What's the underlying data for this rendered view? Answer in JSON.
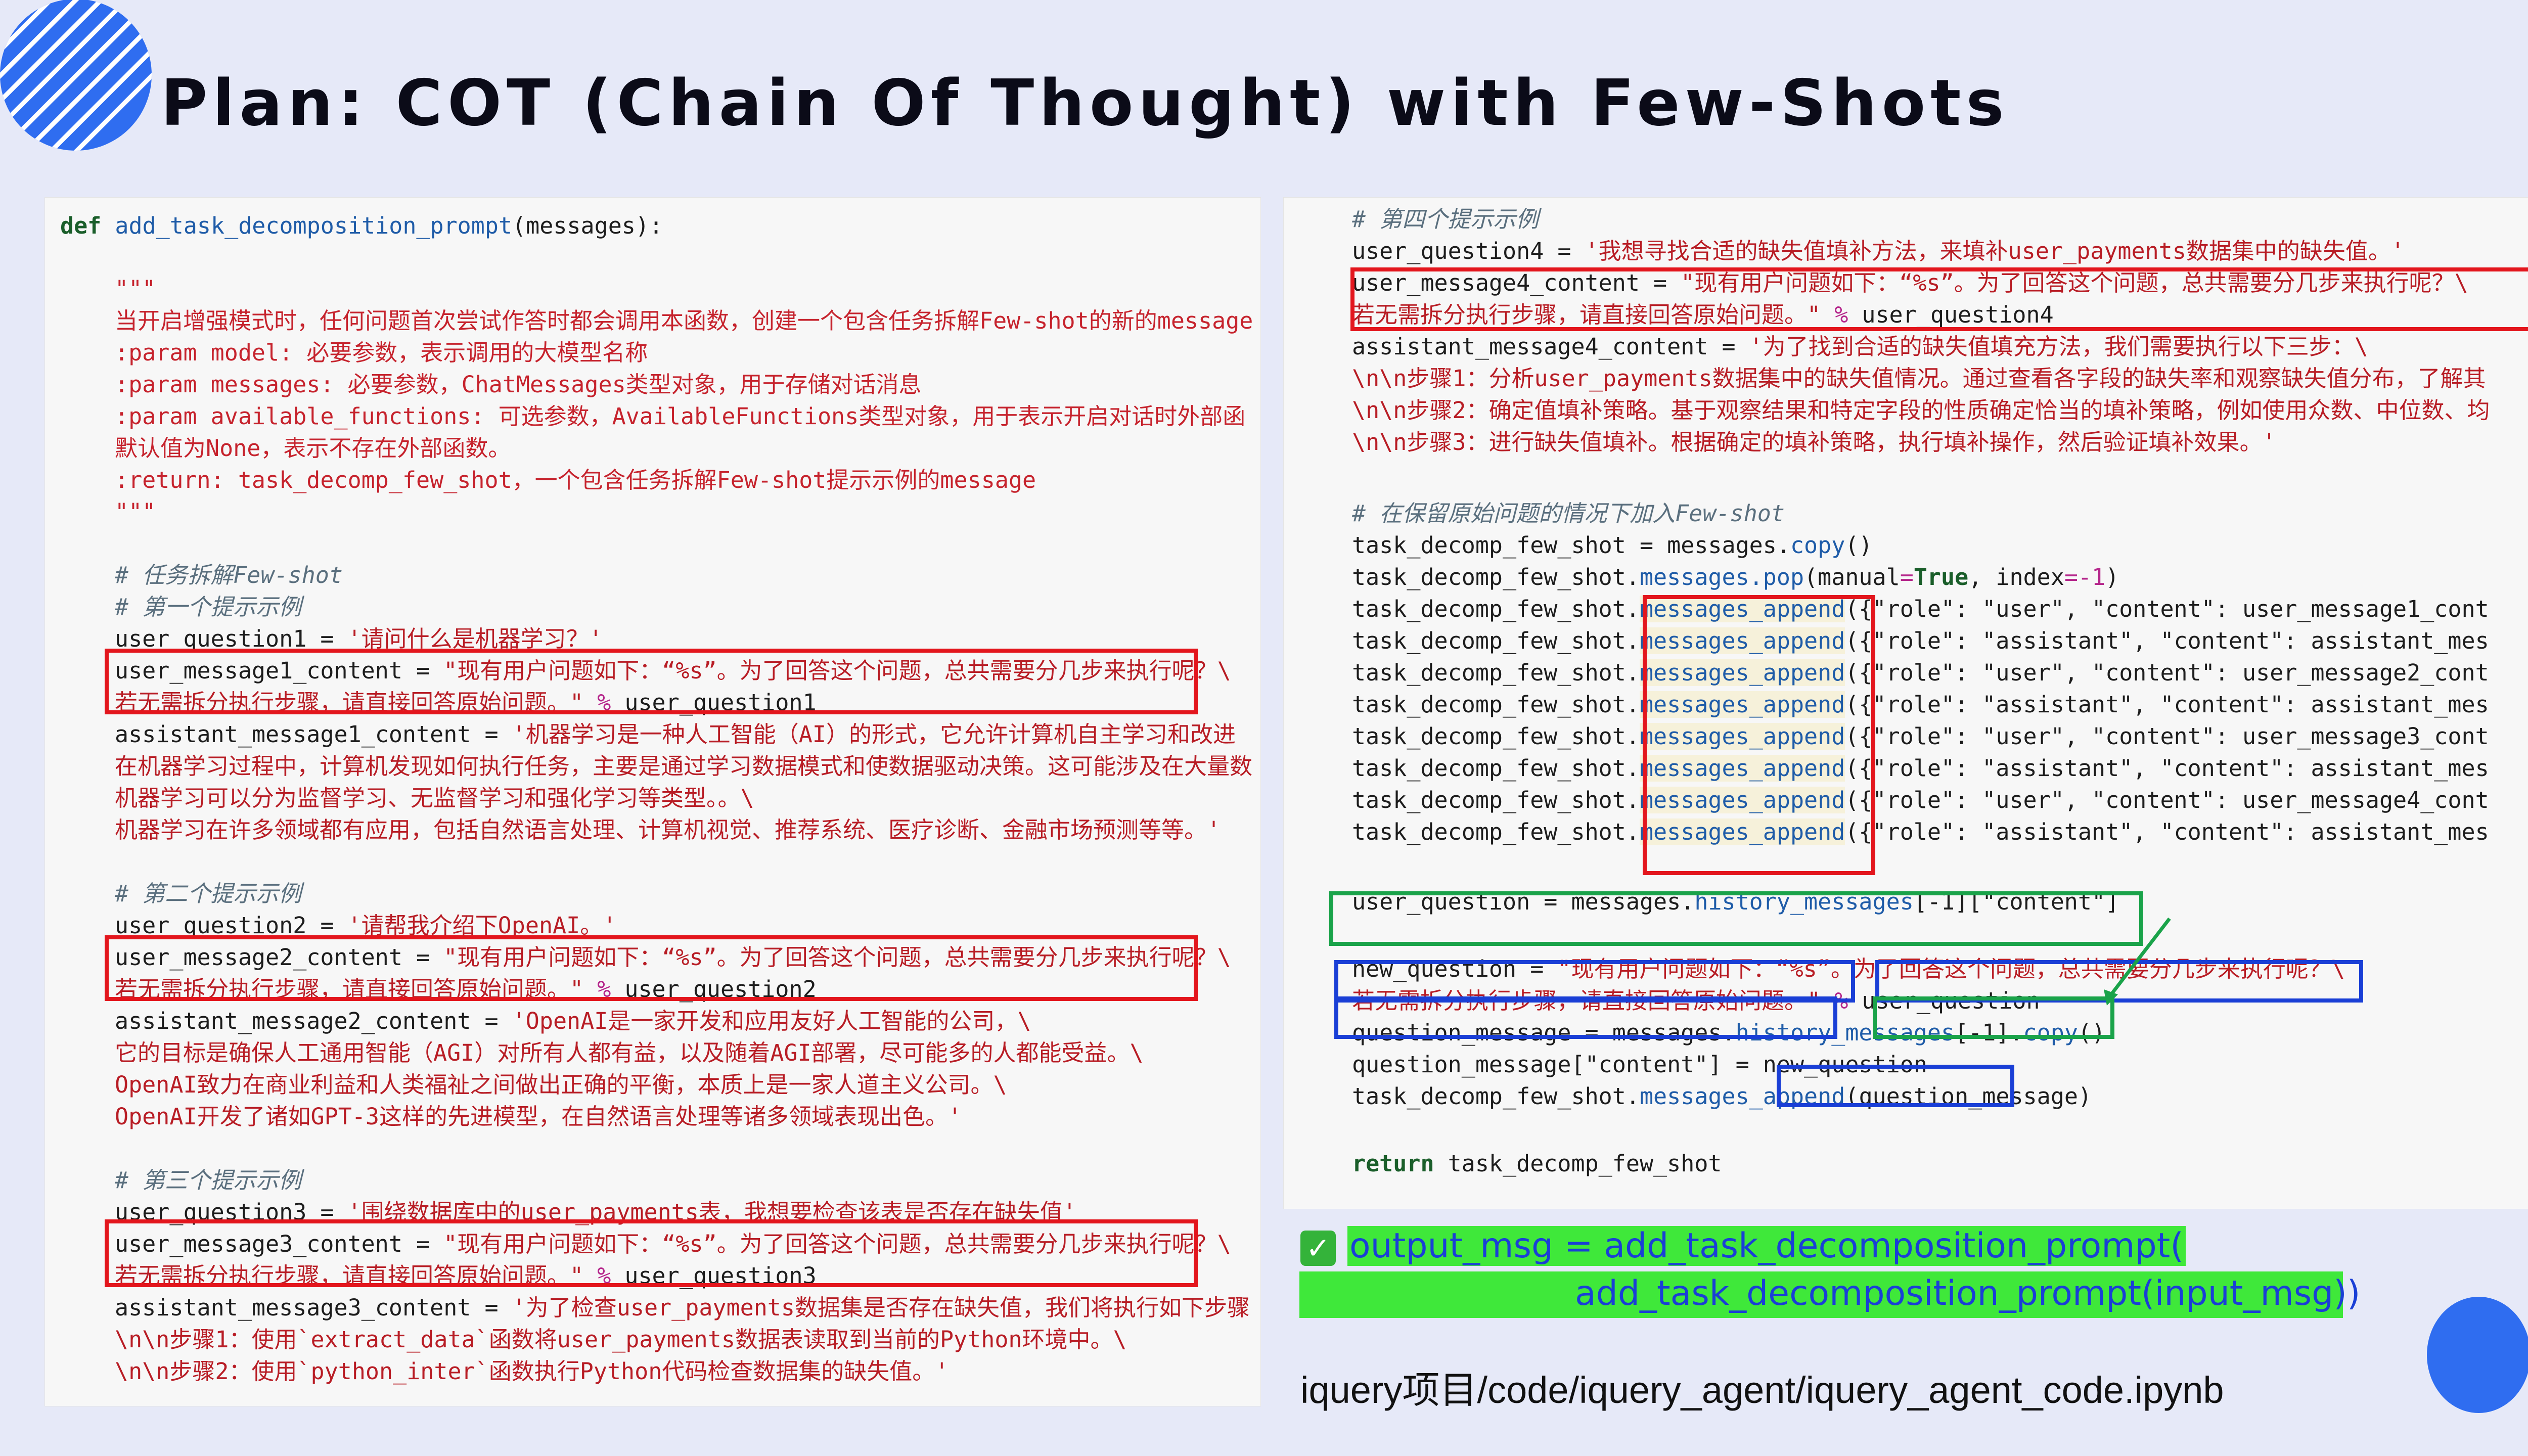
{
  "slide": {
    "title": "Plan: COT (Chain Of Thought) with Few-Shots",
    "output_line1": "output_msg = add_task_decomposition_prompt(",
    "output_line2": "add_task_decomposition_prompt(input_msg))",
    "path": "iquery项目/code/iquery_agent/iquery_agent_code.ipynb",
    "check_icon": "check-icon",
    "colors": {
      "accent_blue": "#2f6df0",
      "highlight_green": "#3fe83a",
      "box_red": "#e3161d",
      "box_green": "#1aa34a",
      "box_blue": "#1a3fd6"
    }
  },
  "left_code": {
    "l1_def": "def",
    "l1_fn": "add_task_decomposition_prompt",
    "l1_rest": "(messages):",
    "doc_open": "\"\"\"",
    "doc1": "当开启增强模式时，任何问题首次尝试作答时都会调用本函数，创建一个包含任务拆解Few-shot的新的message",
    "doc2": ":param model: 必要参数，表示调用的大模型名称",
    "doc3": ":param messages: 必要参数，ChatMessages类型对象，用于存储对话消息",
    "doc4": ":param available_functions: 可选参数，AvailableFunctions类型对象，用于表示开启对话时外部函",
    "doc5": "默认值为None，表示不存在外部函数。",
    "doc6": ":return: task_decomp_few_shot，一个包含任务拆解Few-shot提示示例的message",
    "doc_close": "\"\"\"",
    "c1": "# 任务拆解Few-shot",
    "c2": "# 第一个提示示例",
    "q1a": "user_question1 = ",
    "q1b": "'请问什么是机器学习？'",
    "m1a": "user_message1_content = ",
    "m1b": "\"现有用户问题如下：“%s”。为了回答这个问题，总共需要分几步来执行呢？\\",
    "m1c": "若无需拆分执行步骤，请直接回答原始问题。\" ",
    "m1d": "% ",
    "m1e": "user_question1",
    "a1a": "assistant_message1_content = ",
    "a1b": "'机器学习是一种人工智能（AI）的形式，它允许计算机自主学习和改进",
    "a1c": "在机器学习过程中，计算机发现如何执行任务，主要是通过学习数据模式和使数据驱动决策。这可能涉及在大量数",
    "a1d": "机器学习可以分为监督学习、无监督学习和强化学习等类型。。\\",
    "a1e": "机器学习在许多领域都有应用，包括自然语言处理、计算机视觉、推荐系统、医疗诊断、金融市场预测等等。'",
    "c3": "# 第二个提示示例",
    "q2a": "user_question2 = ",
    "q2b": "'请帮我介绍下OpenAI。'",
    "m2a": "user_message2_content = ",
    "m2b": "\"现有用户问题如下：“%s”。为了回答这个问题，总共需要分几步来执行呢？\\",
    "m2c": "若无需拆分执行步骤，请直接回答原始问题。\" ",
    "m2d": "% ",
    "m2e": "user_question2",
    "a2a": "assistant_message2_content = ",
    "a2b": "'OpenAI是一家开发和应用友好人工智能的公司，\\",
    "a2c": "它的目标是确保人工通用智能（AGI）对所有人都有益，以及随着AGI部署，尽可能多的人都能受益。\\",
    "a2d": "OpenAI致力在商业利益和人类福祉之间做出正确的平衡，本质上是一家人道主义公司。\\",
    "a2e": "OpenAI开发了诸如GPT-3这样的先进模型，在自然语言处理等诸多领域表现出色。'",
    "c4": "# 第三个提示示例",
    "q3a": "user_question3 = ",
    "q3b": "'围绕数据库中的user_payments表，我想要检查该表是否存在缺失值'",
    "m3a": "user_message3_content = ",
    "m3b": "\"现有用户问题如下：“%s”。为了回答这个问题，总共需要分几步来执行呢？\\",
    "m3c": "若无需拆分执行步骤，请直接回答原始问题。\" ",
    "m3d": "% ",
    "m3e": "user_question3",
    "a3a": "assistant_message3_content = ",
    "a3b": "'为了检查user_payments数据集是否存在缺失值，我们将执行如下步骤",
    "a3c": "\\n\\n步骤1：使用`extract_data`函数将user_payments数据表读取到当前的Python环境中。\\",
    "a3d": "\\n\\n步骤2：使用`python_inter`函数执行Python代码检查数据集的缺失值。'"
  },
  "right_code": {
    "c1": "# 第四个提示示例",
    "q4a": "user_question4 = ",
    "q4b": "'我想寻找合适的缺失值填补方法，来填补user_payments数据集中的缺失值。'",
    "m4a": "user_message4_content = ",
    "m4b": "\"现有用户问题如下：“%s”。为了回答这个问题，总共需要分几步来执行呢？\\",
    "m4c": "若无需拆分执行步骤，请直接回答原始问题。\" ",
    "m4d": "% ",
    "m4e": "user_question4",
    "a4a": "assistant_message4_content = ",
    "a4b": "'为了找到合适的缺失值填充方法，我们需要执行以下三步：\\",
    "a4c": "\\n\\n步骤1：分析user_payments数据集中的缺失值情况。通过查看各字段的缺失率和观察缺失值分布，了解其",
    "a4d": "\\n\\n步骤2：确定值填补策略。基于观察结果和特定字段的性质确定恰当的填补策略，例如使用众数、中位数、均",
    "a4e": "\\n\\n步骤3：进行缺失值填补。根据确定的填补策略，执行填补操作，然后验证填补效果。'",
    "c2": "# 在保留原始问题的情况下加入Few-shot",
    "t1a": "task_decomp_few_shot = messages.",
    "t1b": "copy",
    "t1c": "()",
    "t2a": "task_decomp_few_shot.",
    "t2b": "messages.pop",
    "t2c": "(manual",
    "t2d": "=",
    "t2e": "True",
    "t2f": ", index",
    "t2g": "=-1",
    "t2h": ")",
    "ap_prefix": "task_decomp_few_shot.",
    "ap_method": "messages_append",
    "appends": [
      "({\"role\": \"user\", \"content\": user_message1_cont",
      "({\"role\": \"assistant\", \"content\": assistant_mes",
      "({\"role\": \"user\", \"content\": user_message2_cont",
      "({\"role\": \"assistant\", \"content\": assistant_mes",
      "({\"role\": \"user\", \"content\": user_message3_cont",
      "({\"role\": \"assistant\", \"content\": assistant_mes",
      "({\"role\": \"user\", \"content\": user_message4_cont",
      "({\"role\": \"assistant\", \"content\": assistant_mes"
    ],
    "uq_a": "user_question = messages.",
    "uq_b": "history_messages",
    "uq_c": "[-1][\"content\"]",
    "nq_a": "new_question = ",
    "nq_b": "\"现有用户问题如下：“%s”。为了回答这个问题，总共需要分几步来执行呢？\\",
    "nq_c": "若无需拆分执行步骤，请直接回答原始问题。\" ",
    "nq_d": "% ",
    "nq_e": "user_question",
    "qm_a": "question_message = messages.",
    "qm_b": "history_messages",
    "qm_c": "[-1].",
    "qm_d": "copy",
    "qm_e": "()",
    "qc_a": "question_message[\"content\"] = new_question",
    "ta_a": "task_decomp_few_shot.",
    "ta_b": "messages_append",
    "ta_c": "(question_message)",
    "ret_kw": "return",
    "ret_val": " task_decomp_few_shot"
  }
}
